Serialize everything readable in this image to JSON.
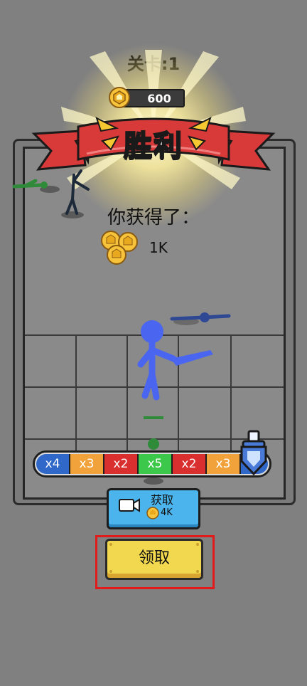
{
  "level": {
    "label": "关卡:1"
  },
  "coins": {
    "value": "600"
  },
  "banner": {
    "title": "胜利"
  },
  "reward": {
    "label": "你获得了：",
    "amount": "1K"
  },
  "multipliers": [
    {
      "label": "x4",
      "color": "#2f68c8"
    },
    {
      "label": "x3",
      "color": "#f2a23a"
    },
    {
      "label": "x2",
      "color": "#d92f2f"
    },
    {
      "label": "x5",
      "color": "#3cc84a"
    },
    {
      "label": "x2",
      "color": "#d92f2f"
    },
    {
      "label": "x3",
      "color": "#f2a23a"
    }
  ],
  "video_button": {
    "label": "获取",
    "amount": "4K",
    "icon": "video-camera-icon"
  },
  "claim_button": {
    "label": "领取"
  },
  "colors": {
    "background": "#808080",
    "banner_red": "#d83a3a",
    "coin_gold": "#f6c33b",
    "player_blue": "#4a66f0",
    "enemy_green": "#2f8a3a",
    "claim_yellow": "#f2d84f",
    "video_blue": "#4bb4ec",
    "highlight_red": "#e11b1b"
  }
}
